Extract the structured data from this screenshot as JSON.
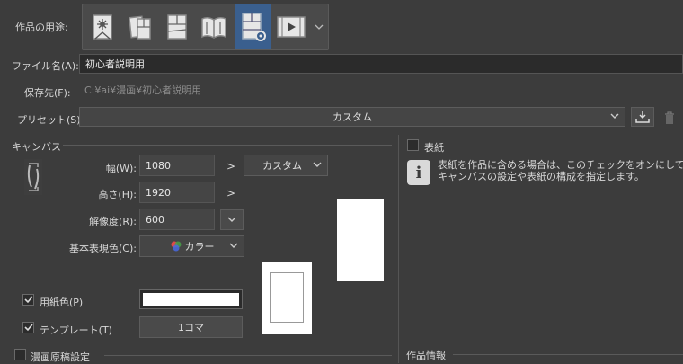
{
  "usage": {
    "label": "作品の用途:",
    "options": [
      {
        "icon": "illustration-icon"
      },
      {
        "icon": "comic-icon"
      },
      {
        "icon": "comic-page-icon"
      },
      {
        "icon": "book-icon"
      },
      {
        "icon": "webtoon-settings-icon",
        "selected": true
      },
      {
        "icon": "animation-icon"
      }
    ]
  },
  "filename": {
    "label": "ファイル名(A):",
    "value": "初心者説明用"
  },
  "save_location": {
    "label": "保存先(F):",
    "value": "C:¥ai¥漫画¥初心者説明用"
  },
  "preset": {
    "label": "プリセット(S):",
    "value": "カスタム"
  },
  "canvas": {
    "section_label": "キャンバス",
    "width_label": "幅(W):",
    "width_value": "1080",
    "height_label": "高さ(H):",
    "height_value": "1920",
    "resolution_label": "解像度(R):",
    "resolution_value": "600",
    "color_label": "基本表現色(C):",
    "color_value": "カラー",
    "size_preset": "カスタム",
    "arrow": ">"
  },
  "paper_color": {
    "label": "用紙色(P)",
    "checked": true,
    "color": "#ffffff"
  },
  "template": {
    "label": "テンプレート(T)",
    "checked": true,
    "value": "1コマ"
  },
  "manga_settings": {
    "label": "漫画原稿設定",
    "checked": false
  },
  "cover": {
    "label": "表紙",
    "checked": false,
    "info_line1": "表紙を作品に含める場合は、このチェックをオンにして",
    "info_line2": "キャンバスの設定や表紙の構成を指定します。"
  },
  "work_info": {
    "label": "作品情報"
  },
  "colors": {
    "background": "#3c3c3c",
    "selected": "#3a5f8e",
    "field": "#2b2b2b"
  }
}
